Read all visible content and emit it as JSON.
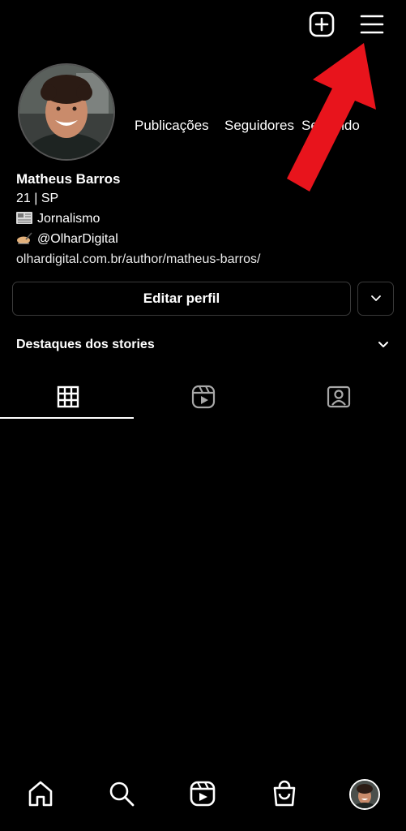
{
  "header": {
    "icons": [
      "plus-square-icon",
      "hamburger-menu-icon"
    ]
  },
  "profile": {
    "stats": {
      "posts_label": "Publicações",
      "followers_label": "Seguidores",
      "following_label": "Seguindo"
    },
    "name": "Matheus Barros",
    "bio_line1": "21 | SP",
    "bio_line2": "Jornalismo",
    "bio_line3": "@OlharDigital",
    "link": "olhardigital.com.br/author/matheus-barros/"
  },
  "actions": {
    "edit_label": "Editar perfil"
  },
  "highlights": {
    "title": "Destaques dos stories"
  },
  "tabs": [
    {
      "icon": "grid-icon",
      "active": true
    },
    {
      "icon": "reels-icon",
      "active": false
    },
    {
      "icon": "tagged-icon",
      "active": false
    }
  ],
  "bottom_nav": [
    "home-icon",
    "search-icon",
    "reels-icon",
    "shop-icon",
    "profile-avatar"
  ],
  "colors": {
    "background": "#000000",
    "text": "#ffffff",
    "annotation_arrow": "#e8141c",
    "border": "#3a3a3a"
  }
}
